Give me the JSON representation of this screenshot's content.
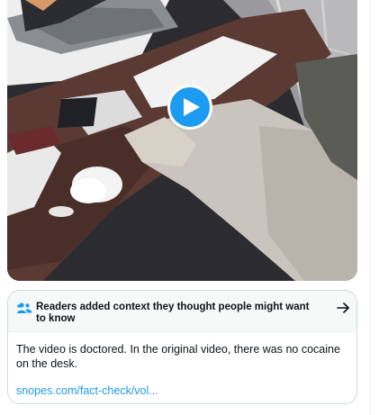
{
  "video": {
    "play_icon": "play-icon"
  },
  "note": {
    "icon": "people-icon",
    "heading": "Readers added context they thought people might want to know",
    "arrow_icon": "arrow-right-icon",
    "body": "The video is doctored. In the original video, there was no cocaine on the desk.",
    "link_text": "snopes.com/fact-check/vol..."
  },
  "colors": {
    "accent": "#1d9bf0",
    "text": "#0f1419",
    "border": "#cfd9de",
    "header_bg": "#f7f9f9"
  }
}
